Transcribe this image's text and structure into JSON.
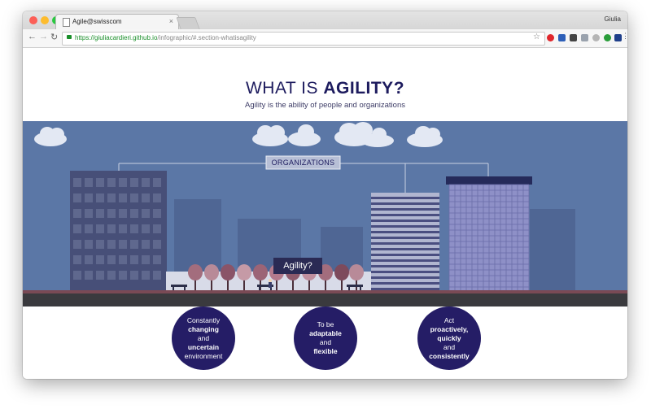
{
  "browser": {
    "tab_title": "Agile@swisscom",
    "tab_close_icon": "×",
    "user_name": "Giulia",
    "url_host": "https://giuliacardieri.github.io",
    "url_path": "/infographic/#.section-whatisagility",
    "colors": {
      "close": "#fc5f57",
      "minimize": "#fdbc2e",
      "maximize": "#29c940",
      "secure": "#1a8f2a"
    }
  },
  "page": {
    "heading_prefix": "WHAT IS ",
    "heading_emphasis": "AGILITY?",
    "subtitle": "Agility is the ability of people and organizations",
    "scene": {
      "organizations_label": "ORGANIZATIONS",
      "agility_label": "Agility?"
    },
    "circles": [
      {
        "l1": "Constantly",
        "l2": "changing",
        "l2b": " and",
        "l3": "uncertain",
        "l4": "environment"
      },
      {
        "l1": "To be",
        "l2": "adaptable",
        "l2b": " and",
        "l3": "flexible",
        "l4": ""
      },
      {
        "l1": "Act",
        "l2": "proactively,",
        "l2b": "",
        "l3": "quickly",
        "l3b": " and",
        "l4": "consistently"
      }
    ],
    "colors": {
      "sky": "#5b77a6",
      "navy": "#1d1b5e",
      "circle": "#251d66",
      "road": "#3a3a3e"
    }
  }
}
